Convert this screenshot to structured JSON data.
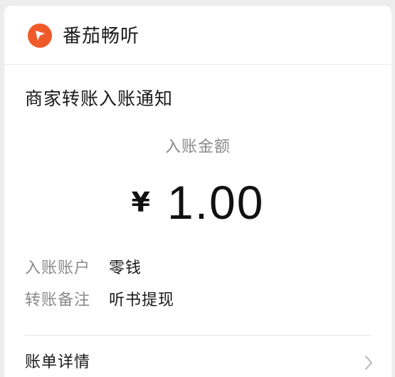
{
  "header": {
    "app_name": "番茄畅听",
    "logo_icon": "fanqie-logo-icon",
    "logo_color": "#f05a2b"
  },
  "notice": {
    "title": "商家转账入账通知",
    "amount_label": "入账金额",
    "currency_symbol": "¥",
    "amount": "1.00",
    "rows": [
      {
        "label": "入账账户",
        "value": "零钱"
      },
      {
        "label": "转账备注",
        "value": "听书提现"
      }
    ]
  },
  "details": {
    "label": "账单详情",
    "icon": "chevron-right-icon"
  }
}
